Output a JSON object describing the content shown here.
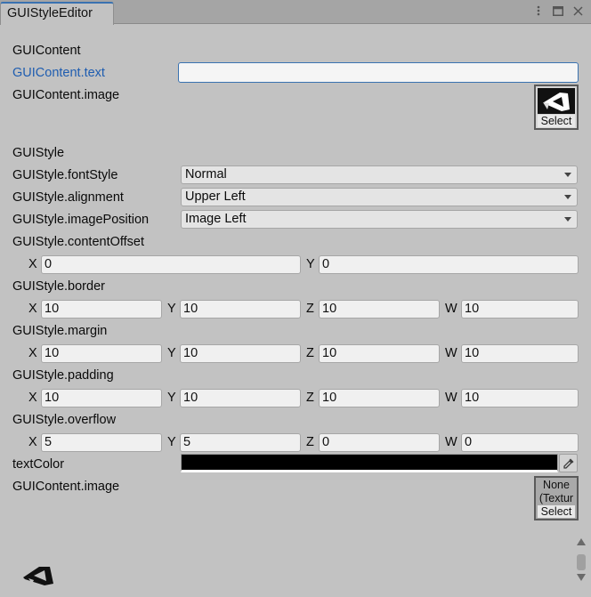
{
  "window": {
    "tab_title": "GUIStyleEditor"
  },
  "content": {
    "section_title": "GUIContent",
    "text_label": "GUIContent.text",
    "text_value": "",
    "image_label": "GUIContent.image",
    "select_label": "Select"
  },
  "style": {
    "section_title": "GUIStyle",
    "fontStyle_label": "GUIStyle.fontStyle",
    "fontStyle_value": "Normal",
    "alignment_label": "GUIStyle.alignment",
    "alignment_value": "Upper Left",
    "imagePosition_label": "GUIStyle.imagePosition",
    "imagePosition_value": "Image Left",
    "contentOffset_label": "GUIStyle.contentOffset",
    "contentOffset": {
      "x": "0",
      "y": "0"
    },
    "border_label": "GUIStyle.border",
    "border": {
      "x": "10",
      "y": "10",
      "z": "10",
      "w": "10"
    },
    "margin_label": "GUIStyle.margin",
    "margin": {
      "x": "10",
      "y": "10",
      "z": "10",
      "w": "10"
    },
    "padding_label": "GUIStyle.padding",
    "padding": {
      "x": "10",
      "y": "10",
      "z": "10",
      "w": "10"
    },
    "overflow_label": "GUIStyle.overflow",
    "overflow": {
      "x": "5",
      "y": "5",
      "z": "0",
      "w": "0"
    },
    "textColor_label": "textColor",
    "textColor": "#000000",
    "image2_label": "GUIContent.image",
    "image2_none": "None (Textur",
    "image2_select": "Select"
  },
  "axes": {
    "x": "X",
    "y": "Y",
    "z": "Z",
    "w": "W"
  },
  "colors": {
    "accent": "#3a72b0",
    "label_blue": "#1f5db0",
    "background": "#c2c2c2"
  }
}
